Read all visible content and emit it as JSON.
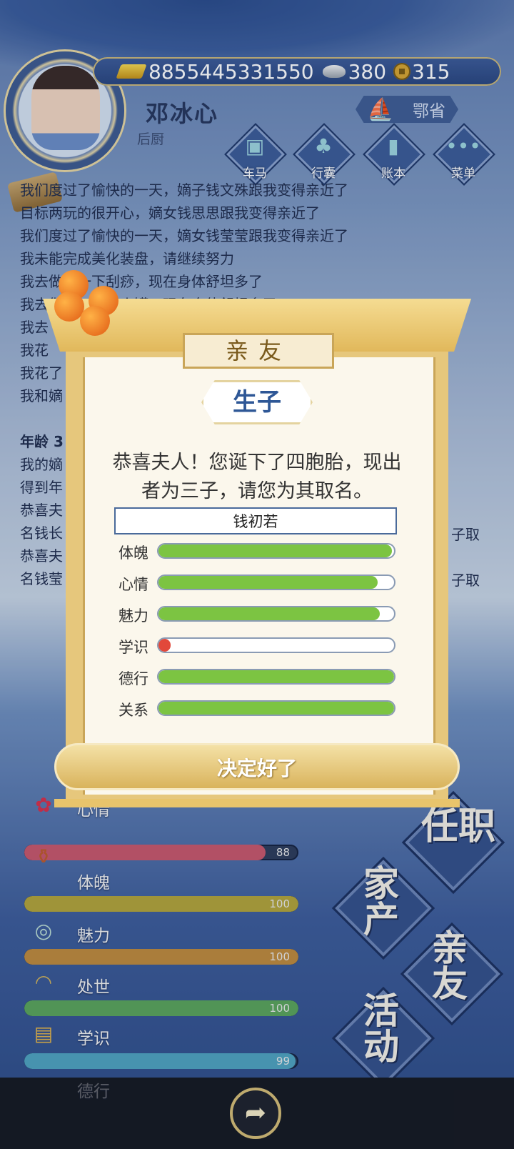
{
  "header": {
    "resources": {
      "gold": "8855445331550",
      "silver": "380",
      "coins": "315"
    },
    "player_name": "邓冰心",
    "rank": "后厨",
    "location": "鄂省",
    "nav_buttons": [
      {
        "label": "车马",
        "icon": "carriage-icon"
      },
      {
        "label": "行囊",
        "icon": "bag-icon"
      },
      {
        "label": "账本",
        "icon": "ledger-icon"
      },
      {
        "label": "菜单",
        "icon": "more-icon"
      }
    ]
  },
  "log": {
    "lines": [
      "我们度过了愉快的一天，嫡子钱文殊跟我变得亲近了",
      "目标两玩的很开心，嫡女钱思思跟我变得亲近了",
      "我们度过了愉快的一天，嫡女钱莹莹跟我变得亲近了",
      "我未能完成美化装盘，请继续努力",
      "我去做了一下刮痧，现在身体舒坦多了",
      "我去做了一下拔火罐，现在身体舒坦多了",
      "我去",
      "我花",
      "我花了",
      "我和嫡"
    ],
    "age_line": "年龄 3",
    "lines2": [
      "我的嫡",
      "得到年",
      "恭喜夫",
      "名钱长",
      "恭喜夫",
      "名钱莹"
    ],
    "right_fragments": [
      "子取",
      "子取"
    ]
  },
  "stats": [
    {
      "label": "心情",
      "value": 88,
      "icon": "flower-icon",
      "color": "#c9576b"
    },
    {
      "label": "体魄",
      "value": 100,
      "icon": "vase-icon",
      "color": "#b3a43a"
    },
    {
      "label": "魅力",
      "value": 100,
      "icon": "jade-icon",
      "color": "#c08a3c"
    },
    {
      "label": "处世",
      "value": 100,
      "icon": "hat-icon",
      "color": "#5aa45a"
    },
    {
      "label": "学识",
      "value": 99,
      "icon": "books-icon",
      "color": "#4fa3c0"
    },
    {
      "label": "德行",
      "value": 100,
      "icon": "virtue-icon",
      "color": "#8a5ab0"
    }
  ],
  "big_buttons": [
    "任职",
    "家产",
    "亲友",
    "活动"
  ],
  "dialog": {
    "tab_title": "亲友",
    "title": "生子",
    "message_line1": "恭喜夫人！您诞下了四胞胎，现出",
    "message_line2": "者为三子，请您为其取名。",
    "name_value": "钱初若",
    "attributes": [
      {
        "label": "体魄",
        "value": 0.99,
        "color": "#7cc442"
      },
      {
        "label": "心情",
        "value": 0.93,
        "color": "#7cc442"
      },
      {
        "label": "魅力",
        "value": 0.94,
        "color": "#7cc442"
      },
      {
        "label": "学识",
        "value": 0.05,
        "color": "#e2483a"
      },
      {
        "label": "德行",
        "value": 1.0,
        "color": "#7cc442"
      },
      {
        "label": "关系",
        "value": 1.0,
        "color": "#7cc442"
      }
    ],
    "confirm_label": "决定好了"
  }
}
